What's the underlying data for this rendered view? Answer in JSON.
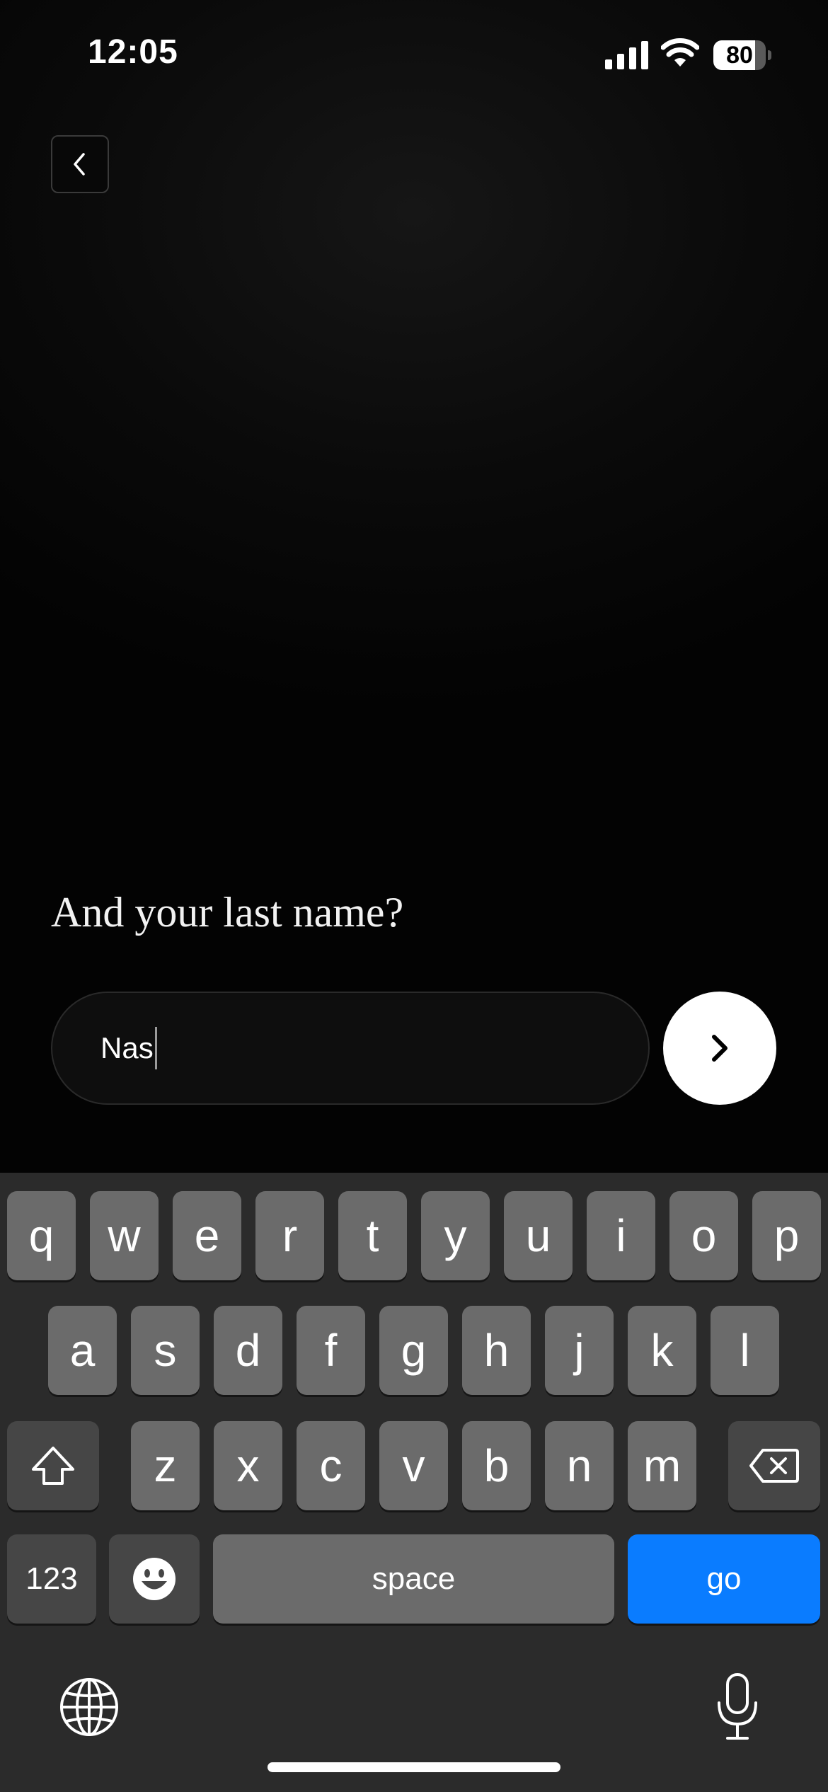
{
  "status_bar": {
    "time": "12:05",
    "battery_percent": "80",
    "battery_level": 0.8
  },
  "screen": {
    "prompt": "And your last name?",
    "input_value": "Nas"
  },
  "keyboard": {
    "row1": [
      "q",
      "w",
      "e",
      "r",
      "t",
      "y",
      "u",
      "i",
      "o",
      "p"
    ],
    "row2": [
      "a",
      "s",
      "d",
      "f",
      "g",
      "h",
      "j",
      "k",
      "l"
    ],
    "row3": [
      "z",
      "x",
      "c",
      "v",
      "b",
      "n",
      "m"
    ],
    "numbers_label": "123",
    "space_label": "space",
    "go_label": "go"
  },
  "icons": {
    "back": "chevron-left-icon",
    "next": "chevron-right-icon",
    "shift": "shift-icon",
    "delete": "backspace-icon",
    "emoji": "emoji-icon",
    "globe": "globe-icon",
    "mic": "microphone-icon"
  },
  "colors": {
    "go_key": "#0a7cff",
    "keyboard_bg": "#2b2b2b",
    "key": "#6b6b6b"
  }
}
